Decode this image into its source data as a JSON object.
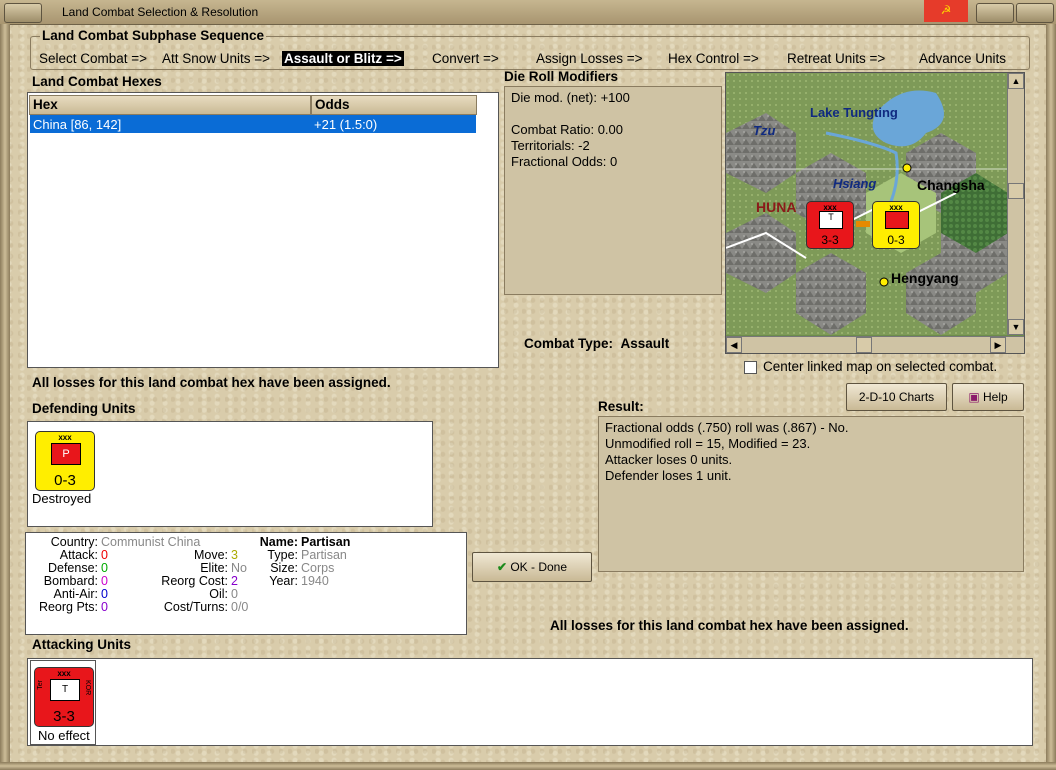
{
  "window": {
    "title": "Land Combat Selection & Resolution"
  },
  "subphase": {
    "title": "Land Combat Subphase Sequence",
    "steps": [
      "Select Combat =>",
      "Att Snow Units =>",
      "Assault or Blitz =>",
      "Convert =>",
      "Assign Losses =>",
      "Hex Control =>",
      "Retreat Units =>",
      "Advance Units"
    ],
    "active_step": "Assault or Blitz =>"
  },
  "hexes": {
    "label": "Land Combat Hexes",
    "columns": [
      "Hex",
      "Odds"
    ],
    "rows": [
      {
        "hex": "China [86, 142]",
        "odds": "+21 (1.5:0)"
      }
    ]
  },
  "die_roll": {
    "label": "Die Roll Modifiers",
    "lines": [
      "Die mod. (net): +100",
      "",
      "Combat Ratio: 0.00",
      "Territorials: -2",
      "Fractional Odds: 0"
    ]
  },
  "map": {
    "labels": {
      "lake": "Lake Tungting",
      "tzu": "Tzu",
      "hsiang": "Hsiang",
      "changsha": "Changsha",
      "hunan": "HUNA",
      "hengyang": "Hengyang"
    },
    "units": {
      "attacker": {
        "xxx": "xxx",
        "symbol": "T",
        "strength": "3-3"
      },
      "defender": {
        "xxx": "xxx",
        "strength": "0-3"
      }
    },
    "colors": {
      "attacker": "#e8161b",
      "defender": "#ffee00"
    }
  },
  "combat_type": {
    "label": "Combat Type:",
    "value": "Assault"
  },
  "center_linked": {
    "label": "Center linked map on selected combat.",
    "checked": false
  },
  "losses_msg": "All losses for this land combat hex have been assigned.",
  "buttons": {
    "charts": "2-D-10 Charts",
    "help": "Help",
    "ok": "OK - Done"
  },
  "defending": {
    "label": "Defending Units",
    "units": [
      {
        "xxx": "xxx",
        "symbol": "P",
        "strength": "0-3",
        "status": "Destroyed"
      }
    ]
  },
  "unit_info": {
    "country_label": "Country:",
    "country": "Communist China",
    "attack_label": "Attack:",
    "attack": "0",
    "defense_label": "Defense:",
    "defense": "0",
    "bombard_label": "Bombard:",
    "bombard": "0",
    "antiair_label": "Anti-Air:",
    "antiair": "0",
    "reorgpts_label": "Reorg Pts:",
    "reorgpts": "0",
    "move_label": "Move:",
    "move": "3",
    "elite_label": "Elite:",
    "elite": "No",
    "reorgcost_label": "Reorg Cost:",
    "reorgcost": "2",
    "oil_label": "Oil:",
    "oil": "0",
    "costturns_label": "Cost/Turns:",
    "costturns": "0/0",
    "name_label": "Name:",
    "name": "Partisan",
    "type_label": "Type:",
    "type": "Partisan",
    "size_label": "Size:",
    "size": "Corps",
    "year_label": "Year:",
    "year": "1940"
  },
  "result": {
    "label": "Result:",
    "lines": [
      "Fractional odds (.750) roll was (.867)  - No.",
      "Unmodified roll = 15, Modified = 23.",
      "Attacker loses 0 units.",
      "Defender loses 1 unit."
    ]
  },
  "attacking": {
    "label": "Attacking Units",
    "units": [
      {
        "xxx": "xxx",
        "symbol": "T",
        "strength": "3-3",
        "side_left": "Ter",
        "side_right": "KOR",
        "status": "No effect"
      }
    ]
  }
}
